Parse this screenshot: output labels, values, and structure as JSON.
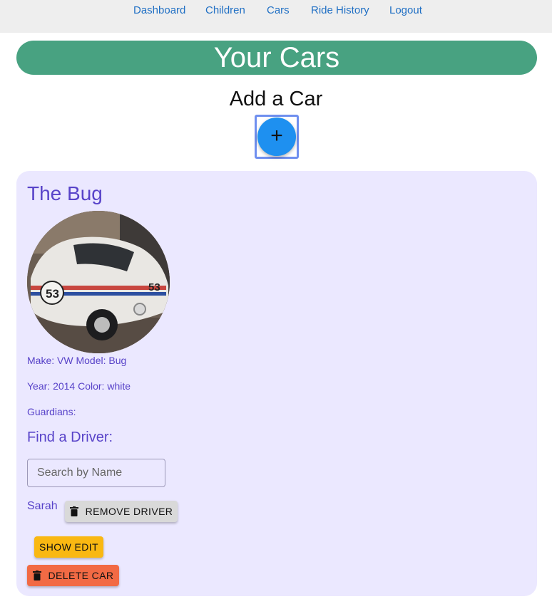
{
  "nav": {
    "items": [
      {
        "label": "Dashboard"
      },
      {
        "label": "Children"
      },
      {
        "label": "Cars"
      },
      {
        "label": "Ride History"
      },
      {
        "label": "Logout"
      }
    ]
  },
  "page": {
    "title": "Your Cars",
    "add_heading": "Add a Car",
    "add_button_symbol": "+"
  },
  "car": {
    "name": "The Bug",
    "photo_icon": "car-photo",
    "make_model": "Make: VW Model: Bug",
    "year_color": "Year: 2014 Color: white",
    "guardians_label": "Guardians:",
    "find_driver_heading": "Find a Driver:",
    "search": {
      "placeholder": "Search by Name",
      "value": ""
    },
    "drivers": [
      {
        "name": "Sarah",
        "remove_label": "REMOVE DRIVER"
      }
    ],
    "show_edit_label": "SHOW EDIT",
    "delete_label": "DELETE CAR"
  },
  "colors": {
    "banner": "#48a281",
    "card_bg": "#ebe8ff",
    "accent_text": "#5843c9",
    "fab": "#1e90f0",
    "edit_button": "#f9b812",
    "delete_button": "#f26a44",
    "remove_button": "#d9d9d9",
    "nav_link": "#1f6fc4"
  }
}
